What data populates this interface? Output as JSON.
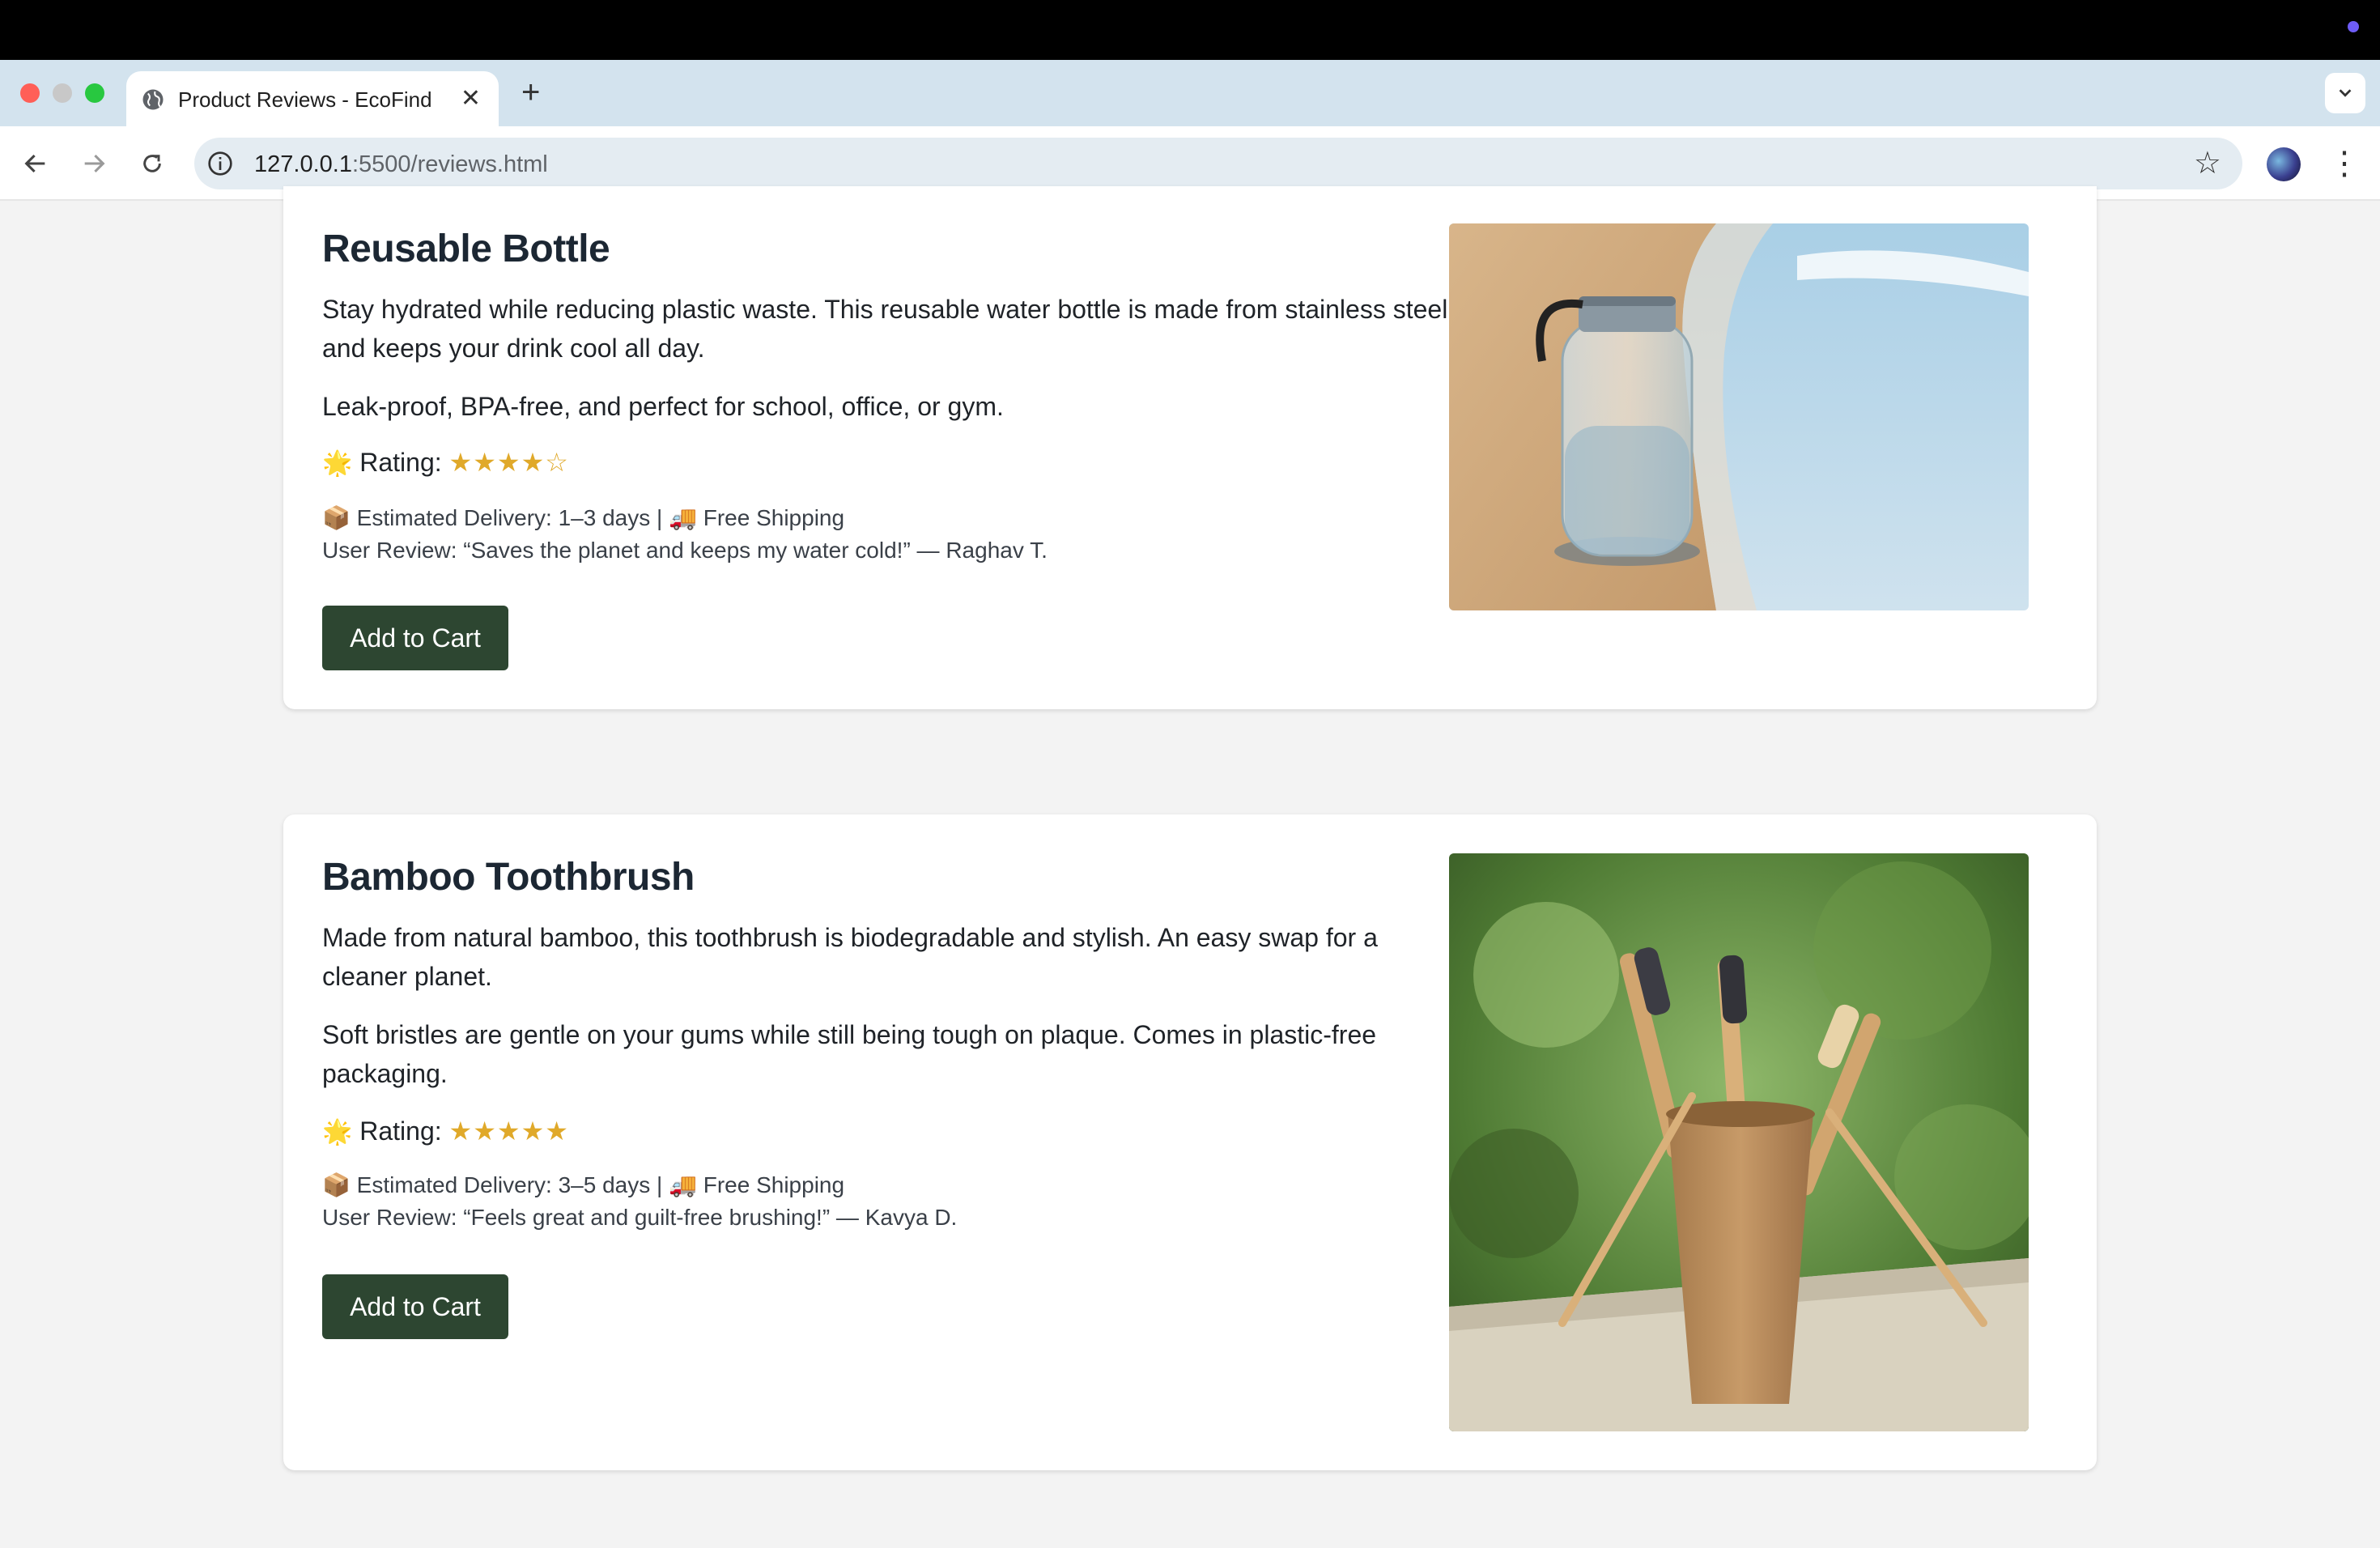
{
  "browser": {
    "tab_title": "Product Reviews - EcoFind",
    "close_symbol": "✕",
    "new_tab_symbol": "+",
    "url_host": "127.0.0.1",
    "url_rest": ":5500/reviews.html"
  },
  "products": [
    {
      "title": "Reusable Bottle",
      "desc1": "Stay hydrated while reducing plastic waste. This reusable water bottle is made from stainless steel and keeps your drink cool all day.",
      "desc2": "Leak-proof, BPA-free, and perfect for school, office, or gym.",
      "rating_label": "Rating:",
      "stars": "★★★★☆",
      "rating_value": 4,
      "delivery": "📦 Estimated Delivery: 1–3 days | 🚚 Free Shipping",
      "review": "User Review: “Saves the planet and keeps my water cold!” — Raghav T.",
      "button": "Add to Cart"
    },
    {
      "title": "Bamboo Toothbrush",
      "desc1": "Made from natural bamboo, this toothbrush is biodegradable and stylish. An easy swap for a cleaner planet.",
      "desc2": "Soft bristles are gentle on your gums while still being tough on plaque. Comes in plastic-free packaging.",
      "rating_label": "Rating:",
      "stars": "★★★★★",
      "rating_value": 5,
      "delivery": "📦 Estimated Delivery: 3–5 days | 🚚 Free Shipping",
      "review": "User Review: “Feels great and guilt-free brushing!” — Kavya D.",
      "button": "Add to Cart"
    }
  ],
  "colors": {
    "button_bg": "#2d4631",
    "page_bg": "#f3f3f3",
    "star": "#e0a92a"
  }
}
